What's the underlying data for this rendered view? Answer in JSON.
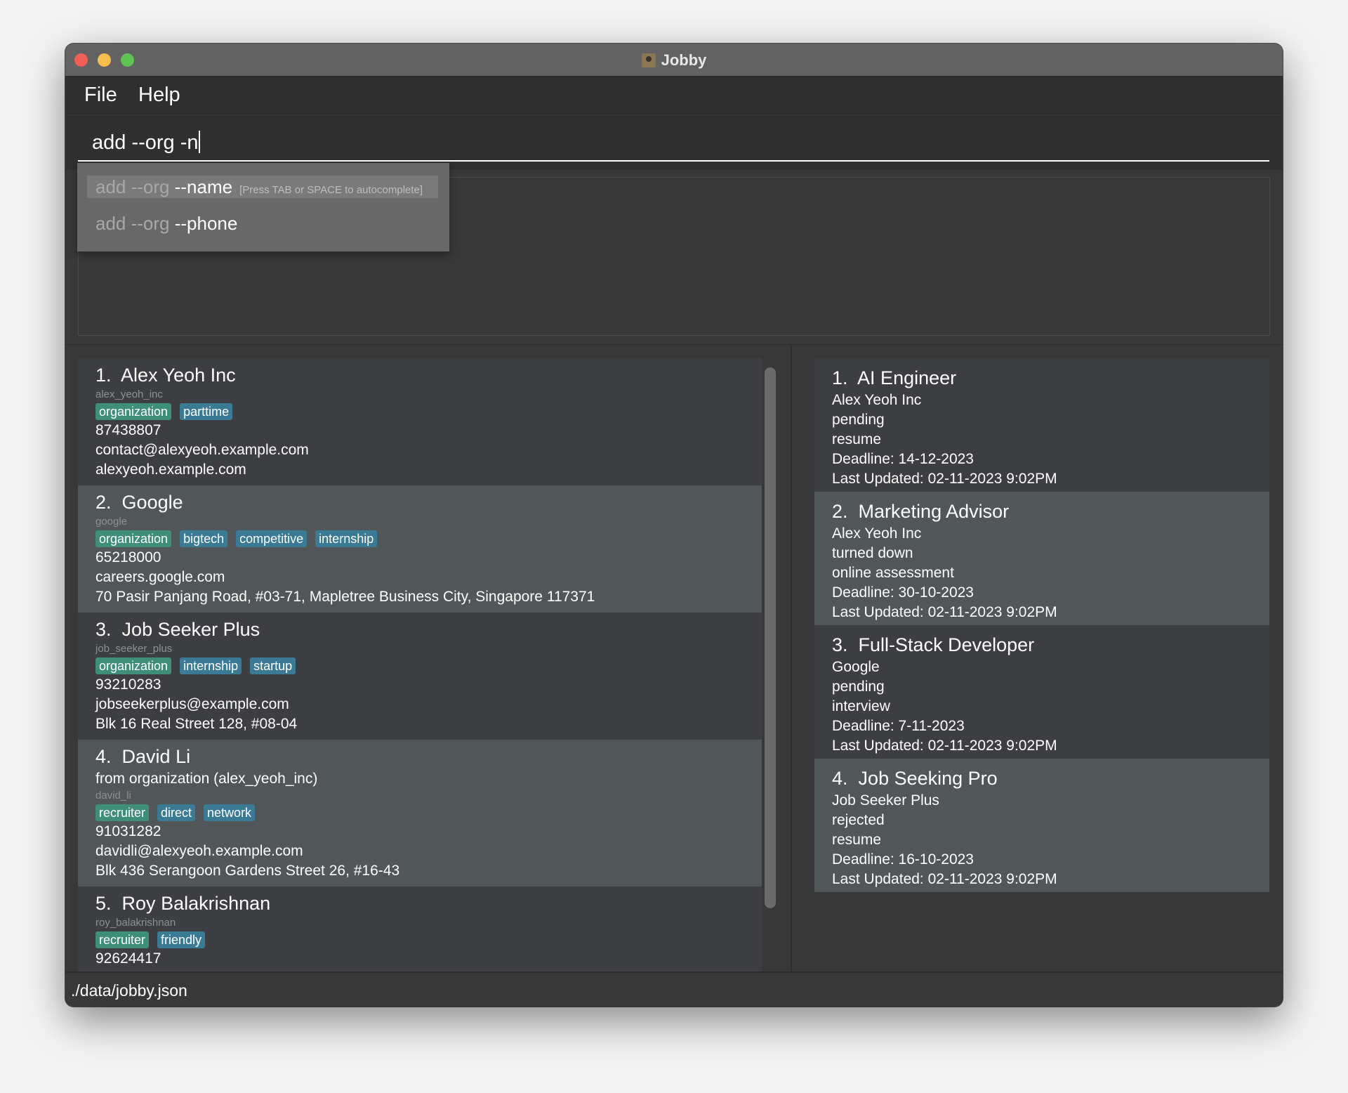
{
  "window": {
    "title": "Jobby",
    "controls": {
      "close": "#ee5f57",
      "minimize": "#f5bd4f",
      "zoom": "#5fc454"
    }
  },
  "menu": {
    "items": [
      "File",
      "Help"
    ]
  },
  "command": {
    "value": "add --org -n"
  },
  "autocomplete": {
    "items": [
      {
        "prefix": "add --org",
        "completion": "--name",
        "hint": "[Press TAB or SPACE to autocomplete]"
      },
      {
        "prefix": "add --org",
        "completion": "--phone",
        "hint": ""
      }
    ]
  },
  "result": {
    "text": ""
  },
  "contacts": [
    {
      "index": "1.",
      "name": "Alex Yeoh Inc",
      "from": "",
      "id": "alex_yeoh_inc",
      "tags": [
        {
          "label": "organization",
          "kind": "g"
        },
        {
          "label": "parttime",
          "kind": "b"
        }
      ],
      "lines": [
        "87438807",
        "contact@alexyeoh.example.com",
        "alexyeoh.example.com"
      ]
    },
    {
      "index": "2.",
      "name": "Google",
      "from": "",
      "id": "google",
      "tags": [
        {
          "label": "organization",
          "kind": "g"
        },
        {
          "label": "bigtech",
          "kind": "b"
        },
        {
          "label": "competitive",
          "kind": "b"
        },
        {
          "label": "internship",
          "kind": "b"
        }
      ],
      "lines": [
        "65218000",
        "careers.google.com",
        "70 Pasir Panjang Road, #03-71, Mapletree Business City, Singapore 117371"
      ]
    },
    {
      "index": "3.",
      "name": "Job Seeker Plus",
      "from": "",
      "id": "job_seeker_plus",
      "tags": [
        {
          "label": "organization",
          "kind": "g"
        },
        {
          "label": "internship",
          "kind": "b"
        },
        {
          "label": "startup",
          "kind": "b"
        }
      ],
      "lines": [
        "93210283",
        "jobseekerplus@example.com",
        "Blk 16 Real Street 128, #08-04"
      ]
    },
    {
      "index": "4.",
      "name": "David Li",
      "from": "from organization (alex_yeoh_inc)",
      "id": "david_li",
      "tags": [
        {
          "label": "recruiter",
          "kind": "g"
        },
        {
          "label": "direct",
          "kind": "b"
        },
        {
          "label": "network",
          "kind": "b"
        }
      ],
      "lines": [
        "91031282",
        "davidli@alexyeoh.example.com",
        "Blk 436 Serangoon Gardens Street 26, #16-43"
      ]
    },
    {
      "index": "5.",
      "name": "Roy Balakrishnan",
      "from": "",
      "id": "roy_balakrishnan",
      "tags": [
        {
          "label": "recruiter",
          "kind": "g"
        },
        {
          "label": "friendly",
          "kind": "b"
        }
      ],
      "lines": [
        "92624417"
      ]
    }
  ],
  "applications": [
    {
      "index": "1.",
      "title": "AI Engineer",
      "lines": [
        "Alex Yeoh Inc",
        "pending",
        "resume",
        "Deadline: 14-12-2023",
        "Last Updated: 02-11-2023 9:02PM"
      ]
    },
    {
      "index": "2.",
      "title": "Marketing Advisor",
      "lines": [
        "Alex Yeoh Inc",
        "turned down",
        "online assessment",
        "Deadline: 30-10-2023",
        "Last Updated: 02-11-2023 9:02PM"
      ]
    },
    {
      "index": "3.",
      "title": "Full-Stack Developer",
      "lines": [
        "Google",
        "pending",
        "interview",
        "Deadline: 7-11-2023",
        "Last Updated: 02-11-2023 9:02PM"
      ]
    },
    {
      "index": "4.",
      "title": "Job Seeking Pro",
      "lines": [
        "Job Seeker Plus",
        "rejected",
        "resume",
        "Deadline: 16-10-2023",
        "Last Updated: 02-11-2023 9:02PM"
      ]
    }
  ],
  "status": {
    "path": "./data/jobby.json"
  }
}
